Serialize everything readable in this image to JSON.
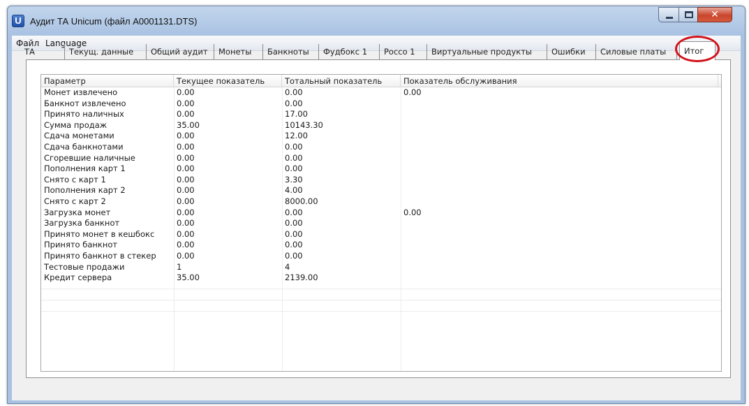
{
  "window": {
    "title": "Аудит ТА Unicum (файл A0001131.DTS)",
    "icon_letter": "U",
    "close_glyph": "✕"
  },
  "menu": [
    "Файл",
    "Language"
  ],
  "tabs": [
    {
      "label": "ТА"
    },
    {
      "label": "Текущ. данные"
    },
    {
      "label": "Общий аудит"
    },
    {
      "label": "Монеты"
    },
    {
      "label": "Банкноты"
    },
    {
      "label": "Фудбокс 1"
    },
    {
      "label": "Рocco 1"
    },
    {
      "label": "Виртуальные продукты"
    },
    {
      "label": "Ошибки"
    },
    {
      "label": "Силовые платы"
    },
    {
      "label": "Итог",
      "active": true
    }
  ],
  "table": {
    "columns": [
      "Параметр",
      "Текущее показатель",
      "Тотальный показатель",
      "Показатель обслуживания"
    ],
    "rows": [
      [
        "Монет извлечено",
        "0.00",
        "0.00",
        "0.00"
      ],
      [
        "Банкнот извлечено",
        "0.00",
        "0.00",
        ""
      ],
      [
        "Принято наличных",
        "0.00",
        "17.00",
        ""
      ],
      [
        "Сумма продаж",
        "35.00",
        "10143.30",
        ""
      ],
      [
        "Сдача монетами",
        "0.00",
        "12.00",
        ""
      ],
      [
        "Сдача банкнотами",
        "0.00",
        "0.00",
        ""
      ],
      [
        "Сгоревшие наличные",
        "0.00",
        "0.00",
        ""
      ],
      [
        "Пополнения карт 1",
        "0.00",
        "0.00",
        ""
      ],
      [
        "Снято с карт 1",
        "0.00",
        "3.30",
        ""
      ],
      [
        "Пополнения карт 2",
        "0.00",
        "4.00",
        ""
      ],
      [
        "Снято с карт 2",
        "0.00",
        "8000.00",
        ""
      ],
      [
        "Загрузка монет",
        "0.00",
        "0.00",
        "0.00"
      ],
      [
        "Загрузка банкнот",
        "0.00",
        "0.00",
        ""
      ],
      [
        "Принято монет в кешбокс",
        "0.00",
        "0.00",
        ""
      ],
      [
        "Принято банкнот",
        "0.00",
        "0.00",
        ""
      ],
      [
        "Принято банкнот в стекер",
        "0.00",
        "0.00",
        ""
      ],
      [
        "Тестовые продажи",
        "1",
        "4",
        ""
      ],
      [
        "Кредит сервера",
        "35.00",
        "2139.00",
        ""
      ]
    ]
  },
  "colors": {
    "highlight_circle": "#d2121a",
    "title_bar": "#b4cbe7",
    "close_button": "#c9462c"
  }
}
